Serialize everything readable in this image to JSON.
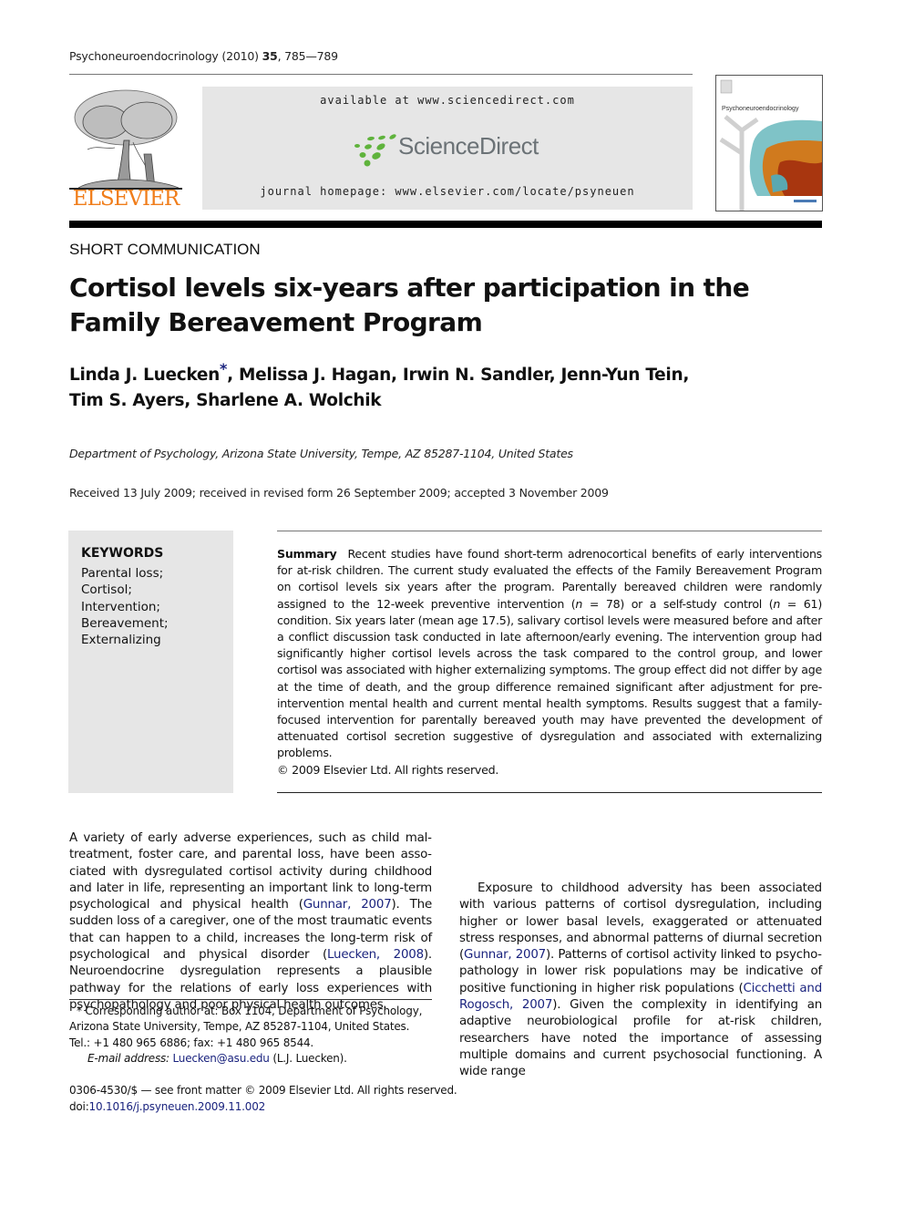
{
  "header": {
    "journal_name": "Psychoneuroendocrinology",
    "year": "(2010)",
    "volume": "35",
    "pages": "785—789",
    "publisher_logo_text": "ELSEVIER",
    "available_at": "available at www.sciencedirect.com",
    "sciencedirect_logo_text": "ScienceDirect",
    "journal_homepage": "journal homepage: www.elsevier.com/locate/psyneuen",
    "cover_title": "Psychoneuroendocrinology"
  },
  "article": {
    "section_type": "SHORT COMMUNICATION",
    "title": "Cortisol levels six-years after participation in the Family Bereavement Program",
    "authors": [
      {
        "name": "Linda J. Luecken",
        "corresponding": true
      },
      {
        "name": "Melissa J. Hagan"
      },
      {
        "name": "Irwin N. Sandler"
      },
      {
        "name": "Jenn-Yun Tein"
      },
      {
        "name": "Tim S. Ayers"
      },
      {
        "name": "Sharlene A. Wolchik"
      }
    ],
    "corresponding_mark": "*",
    "affiliation": "Department of Psychology, Arizona State University, Tempe, AZ 85287-1104, United States",
    "received": "Received 13 July 2009; received in revised form 26 September 2009; accepted 3 November 2009"
  },
  "keywords": {
    "heading": "KEYWORDS",
    "items": [
      "Parental loss;",
      "Cortisol;",
      "Intervention;",
      "Bereavement;",
      "Externalizing"
    ]
  },
  "abstract": {
    "label": "Summary",
    "text_1": "Recent studies have found short-term adrenocortical benefits of early interventions for at-risk children. The current study evaluated the effects of the Family Bereavement Program on cortisol levels six years after the program. Parentally bereaved children were randomly assigned to the 12-week preventive intervention (",
    "n_label": "n",
    "n_intervention": " = 78) or a self-study control (",
    "n_control": " = 61) condition. Six years later (mean age 17.5), salivary cortisol levels were measured before and after a conflict discussion task conducted in late afternoon/early evening. The intervention group had significantly higher cortisol levels across the task compared to the control group, and lower cortisol was associated with higher externalizing symptoms. The group effect did not differ by age at the time of death, and the group difference remained significant after adjustment for pre-intervention mental health and current mental health symptoms. Results suggest that a family-focused intervention for parentally bereaved youth may have prevented the development of attenuated cortisol secretion suggestive of dysregulation and associated with externalizing problems.",
    "copyright": "© 2009 Elsevier Ltd. All rights reserved."
  },
  "body": {
    "left_p1_a": "A variety of early adverse experiences, such as child mal­treatment, foster care, and parental loss, have been asso­ciated with dysregulated cortisol activity during childhood and later in life, representing an important link to long-term psychological and physical health (",
    "cite_gunnar": "Gunnar, 2007",
    "left_p1_b": "). The sudden loss of a caregiver, one of the most traumatic events that can happen to a child, increases the long-term risk of psycholo­gical and physical disorder (",
    "cite_luecken": "Luecken, 2008",
    "left_p1_c": "). Neuroendocrine dysregulation represents a plausible pathway for the rela­tions of early loss experiences with psychopathology and poor physical health outcomes.",
    "right_p2_a": "Exposure to childhood adversity has been associated with various patterns of cortisol dysregulation, including higher or lower basal levels, exaggerated or attenuated stress responses, and abnormal patterns of diurnal secretion (",
    "cite_gunnar2": "Gun­nar, 2007",
    "right_p2_b": "). Patterns of cortisol activity linked to psycho­pathology in lower risk populations may be indicative of positive functioning in higher risk populations (",
    "cite_cicchetti": "Cicchetti and Rogosch, 2007",
    "right_p2_c": "). Given the complexity in identifying an adaptive neurobiological profile for at-risk children, researchers have noted the importance of assessing multiple domains and current psychosocial functioning. A wide range"
  },
  "footnote": {
    "line1": "* Corresponding author at: Box 1104, Department of Psychology, Arizona State University, Tempe, AZ 85287-1104, United States.",
    "line2": "Tel.: +1 480 965 6886; fax: +1 480 965 8544.",
    "email_label": "E-mail address:",
    "email": "Luecken@asu.edu",
    "email_suffix": " (L.J. Luecken)."
  },
  "front_matter": {
    "issn_line": "0306-4530/$ — see front matter © 2009 Elsevier Ltd. All rights reserved.",
    "doi_label": "doi:",
    "doi": "10.1016/j.psyneuen.2009.11.002"
  },
  "colors": {
    "elsevier_orange": "#f07d1a",
    "sciencedirect_green": "#5fb33c",
    "link_blue": "#1a237e",
    "panel_gray": "#e6e6e6"
  }
}
